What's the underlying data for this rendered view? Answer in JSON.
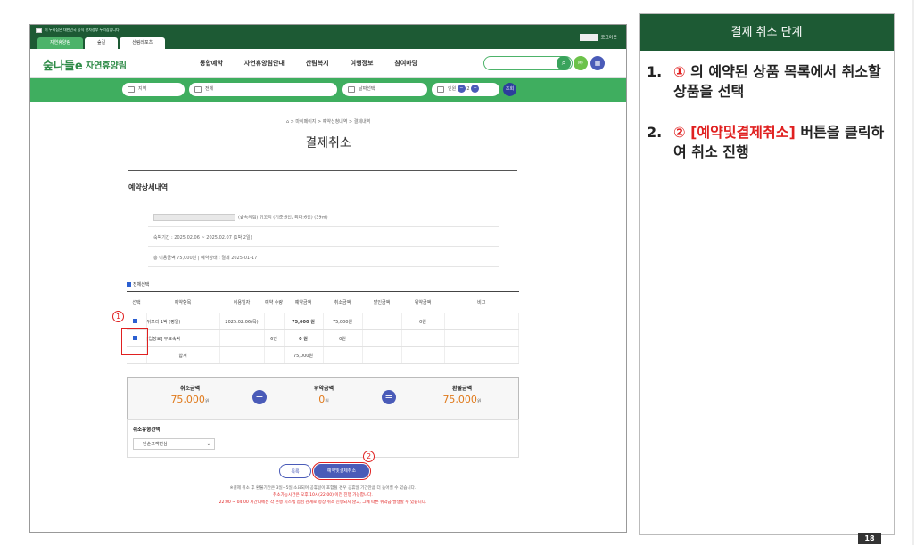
{
  "site": {
    "gov_notice": "이 누리집은 대한민국 공식 전자정부 누리집입니다.",
    "tabs": [
      "자연휴양림",
      "숲길",
      "산림레포츠"
    ],
    "logout": "로그아웃",
    "logo": "숲나들e",
    "brand": "자연휴양림",
    "menu": [
      "통합예약",
      "자연휴양림안내",
      "산림복지",
      "여행정보",
      "참여마당"
    ],
    "filters": {
      "region": "지역",
      "all": "전체",
      "date": "날짜선택",
      "people_label": "인원",
      "people": "2",
      "search": "조회"
    }
  },
  "page": {
    "breadcrumb": "⌂ > 마이페이지 > 예약신청내역 > 결제내역",
    "title": "결제취소",
    "section": "예약상세내역",
    "detail_line1": "(숲속의집) 뒤꼬리 (기준:6인, 최대:6인) (39㎡)",
    "detail_line2": "숙박기간 : 2025.02.06 ~ 2025.02.07 (1박 2일)",
    "detail_line3": "총 이용금액 75,000원 | 예약상태 : 결제 2025-01-17",
    "select_all": "전체선택"
  },
  "table": {
    "headers": [
      "선택",
      "예약항목",
      "이용일자",
      "예약 수량",
      "예약금액",
      "취소금액",
      "할인금액",
      "위약금액",
      "비고"
    ],
    "rows": [
      [
        "",
        "뒤꼬리 1박 (평일)",
        "2025.02.06(목)",
        "",
        "75,000 원",
        "75,000원",
        "",
        "0원",
        ""
      ],
      [
        "",
        "[입장료] 무료숙박",
        "",
        "6인",
        "0 원",
        "0원",
        "",
        "",
        ""
      ]
    ],
    "total_label": "합계",
    "total": "75,000원"
  },
  "summary": {
    "cancel_label": "취소금액",
    "cancel_value": "75,000",
    "cancel_unit": "원",
    "penalty_label": "위약금액",
    "penalty_value": "0",
    "penalty_unit": "원",
    "refund_label": "환불금액",
    "refund_value": "75,000",
    "refund_unit": "원",
    "minus": "−",
    "equals": "="
  },
  "refund_type": {
    "label": "취소유형선택",
    "selected": "단순고객변심"
  },
  "buttons": {
    "list": "목록",
    "cancel": "예약및결제취소"
  },
  "notes": [
    "※결제 취소 후 환불기간은 3일~5일 소요되며 공휴일이 포함될 경우 공휴일 기간만큼 더 늦어질 수 있습니다.",
    "취소가능시간은 오후 10시(22:00) 이전 진행 가능합니다.",
    "22:00 ~ 04:00 시간대에는 각 은행 시스템 점검 관계로 정상 취소 진행되지 않고, 그에 따른 위약금 발생할 수 있습니다."
  ],
  "annotations": {
    "one": "1",
    "two": "2"
  },
  "panel": {
    "title": "결제 취소 단계",
    "step1_num": "1.",
    "step1_mark": "①",
    "step1_text": " 의 예약된 상품 목록에서 취소할 상품을 선택",
    "step2_num": "2.",
    "step2_mark": "② [예약및결제취소]",
    "step2_text": " 버튼을 클릭하여 취소 진행",
    "page_number": "18"
  },
  "colors": {
    "green_dark": "#1d5a34",
    "green": "#3fae5f",
    "accent_orange": "#e07a1c",
    "accent_red": "#e02020",
    "button_blue": "#4a5bb8"
  }
}
